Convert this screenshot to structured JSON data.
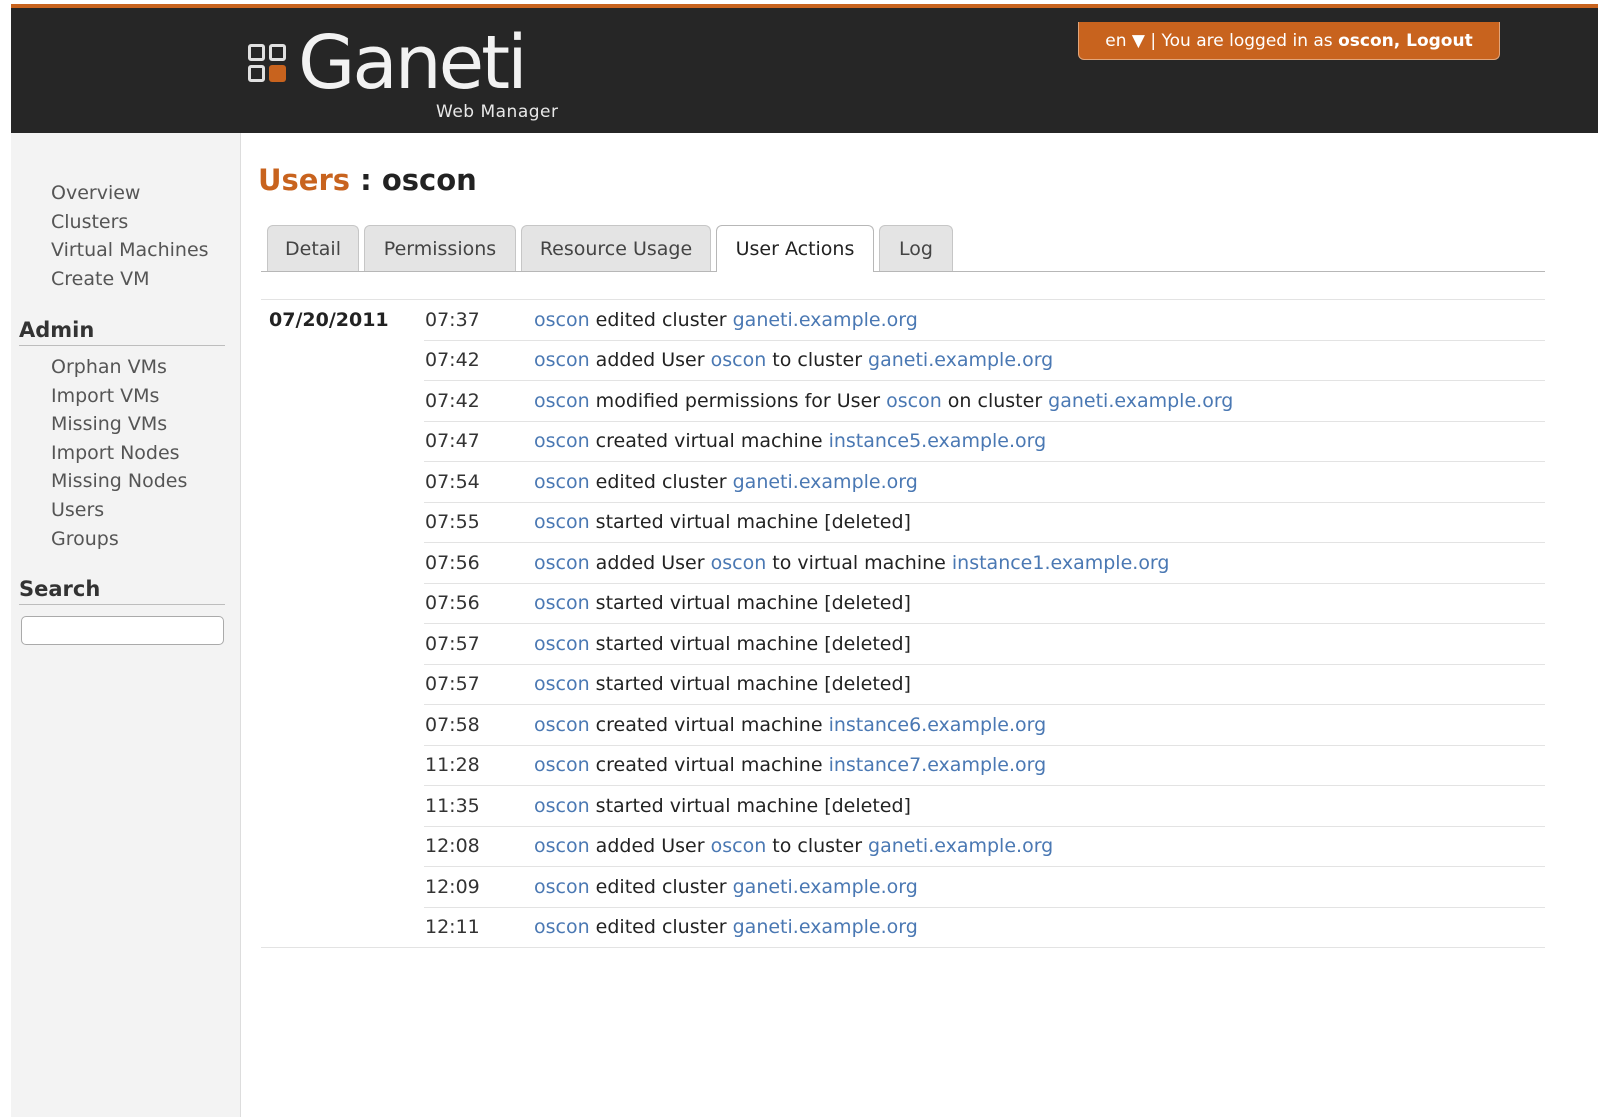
{
  "header": {
    "logo_word": "Ganeti",
    "logo_sub": "Web Manager",
    "lang": "en ▼",
    "logged_in_prefix": " | You are logged in as ",
    "username": "oscon",
    "separator": ", ",
    "logout": "Logout",
    "colors": {
      "bar": "#262626",
      "accent": "#c8631e"
    }
  },
  "sidebar": {
    "nav": [
      "Overview",
      "Clusters",
      "Virtual Machines",
      "Create VM"
    ],
    "admin_heading": "Admin",
    "admin": [
      "Orphan VMs",
      "Import VMs",
      "Missing VMs",
      "Import Nodes",
      "Missing Nodes",
      "Users",
      "Groups"
    ],
    "search_heading": "Search",
    "search_value": ""
  },
  "page": {
    "crumb": "Users",
    "sep": " : ",
    "name": "oscon",
    "link_color": "#4a78b3"
  },
  "tabs": [
    "Detail",
    "Permissions",
    "Resource Usage",
    "User Actions",
    "Log"
  ],
  "active_tab": "User Actions",
  "log": {
    "date": "07/20/2011",
    "entries": [
      {
        "time": "07:37",
        "parts": [
          {
            "t": "oscon",
            "link": true
          },
          {
            "t": " edited cluster "
          },
          {
            "t": "ganeti.example.org",
            "link": true
          }
        ]
      },
      {
        "time": "07:42",
        "parts": [
          {
            "t": "oscon",
            "link": true
          },
          {
            "t": " added User "
          },
          {
            "t": "oscon",
            "link": true
          },
          {
            "t": " to cluster "
          },
          {
            "t": "ganeti.example.org",
            "link": true
          }
        ]
      },
      {
        "time": "07:42",
        "parts": [
          {
            "t": "oscon",
            "link": true
          },
          {
            "t": " modified permissions for User "
          },
          {
            "t": "oscon",
            "link": true
          },
          {
            "t": " on cluster "
          },
          {
            "t": "ganeti.example.org",
            "link": true
          }
        ]
      },
      {
        "time": "07:47",
        "parts": [
          {
            "t": "oscon",
            "link": true
          },
          {
            "t": " created virtual machine "
          },
          {
            "t": "instance5.example.org",
            "link": true
          }
        ]
      },
      {
        "time": "07:54",
        "parts": [
          {
            "t": "oscon",
            "link": true
          },
          {
            "t": " edited cluster "
          },
          {
            "t": "ganeti.example.org",
            "link": true
          }
        ]
      },
      {
        "time": "07:55",
        "parts": [
          {
            "t": "oscon",
            "link": true
          },
          {
            "t": " started virtual machine [deleted]"
          }
        ]
      },
      {
        "time": "07:56",
        "parts": [
          {
            "t": "oscon",
            "link": true
          },
          {
            "t": " added User "
          },
          {
            "t": "oscon",
            "link": true
          },
          {
            "t": " to virtual machine "
          },
          {
            "t": "instance1.example.org",
            "link": true
          }
        ]
      },
      {
        "time": "07:56",
        "parts": [
          {
            "t": "oscon",
            "link": true
          },
          {
            "t": " started virtual machine [deleted]"
          }
        ]
      },
      {
        "time": "07:57",
        "parts": [
          {
            "t": "oscon",
            "link": true
          },
          {
            "t": " started virtual machine [deleted]"
          }
        ]
      },
      {
        "time": "07:57",
        "parts": [
          {
            "t": "oscon",
            "link": true
          },
          {
            "t": " started virtual machine [deleted]"
          }
        ]
      },
      {
        "time": "07:58",
        "parts": [
          {
            "t": "oscon",
            "link": true
          },
          {
            "t": " created virtual machine "
          },
          {
            "t": "instance6.example.org",
            "link": true
          }
        ]
      },
      {
        "time": "11:28",
        "parts": [
          {
            "t": "oscon",
            "link": true
          },
          {
            "t": " created virtual machine "
          },
          {
            "t": "instance7.example.org",
            "link": true
          }
        ]
      },
      {
        "time": "11:35",
        "parts": [
          {
            "t": "oscon",
            "link": true
          },
          {
            "t": " started virtual machine [deleted]"
          }
        ]
      },
      {
        "time": "12:08",
        "parts": [
          {
            "t": "oscon",
            "link": true
          },
          {
            "t": " added User "
          },
          {
            "t": "oscon",
            "link": true
          },
          {
            "t": " to cluster "
          },
          {
            "t": "ganeti.example.org",
            "link": true
          }
        ]
      },
      {
        "time": "12:09",
        "parts": [
          {
            "t": "oscon",
            "link": true
          },
          {
            "t": " edited cluster "
          },
          {
            "t": "ganeti.example.org",
            "link": true
          }
        ]
      },
      {
        "time": "12:11",
        "parts": [
          {
            "t": "oscon",
            "link": true
          },
          {
            "t": " edited cluster "
          },
          {
            "t": "ganeti.example.org",
            "link": true
          }
        ]
      }
    ]
  }
}
